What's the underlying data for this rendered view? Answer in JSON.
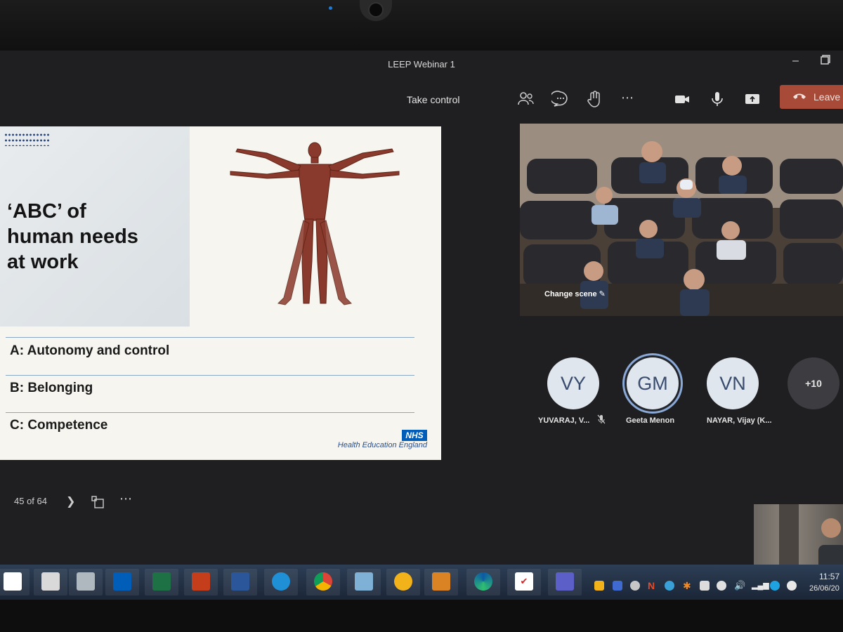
{
  "window": {
    "title": "LEEP Webinar 1"
  },
  "toolbar": {
    "take_control": "Take control",
    "leave_label": "Leave",
    "leave_color": "#a74a37"
  },
  "slide": {
    "title_lines": [
      "‘ABC’ of",
      "human needs",
      "at work"
    ],
    "bullets": [
      "A: Autonomy and control",
      "B: Belonging",
      "C: Competence"
    ],
    "logo_text": "NHS",
    "org_name": "Health Education England",
    "nhs_color": "#005eb8"
  },
  "slide_nav": {
    "counter": "45 of 64"
  },
  "video": {
    "change_scene": "Change scene"
  },
  "participants": [
    {
      "initials": "VY",
      "name": "YUVARAJ, V...",
      "muted": true
    },
    {
      "initials": "GM",
      "name": "Geeta Menon",
      "muted": false,
      "active": true
    },
    {
      "initials": "VN",
      "name": "NAYAR, Vijay (K..."
    }
  ],
  "overflow_count": "+10",
  "taskbar": {
    "time": "11:57",
    "date": "26/06/20",
    "color": "#2d3e55"
  }
}
